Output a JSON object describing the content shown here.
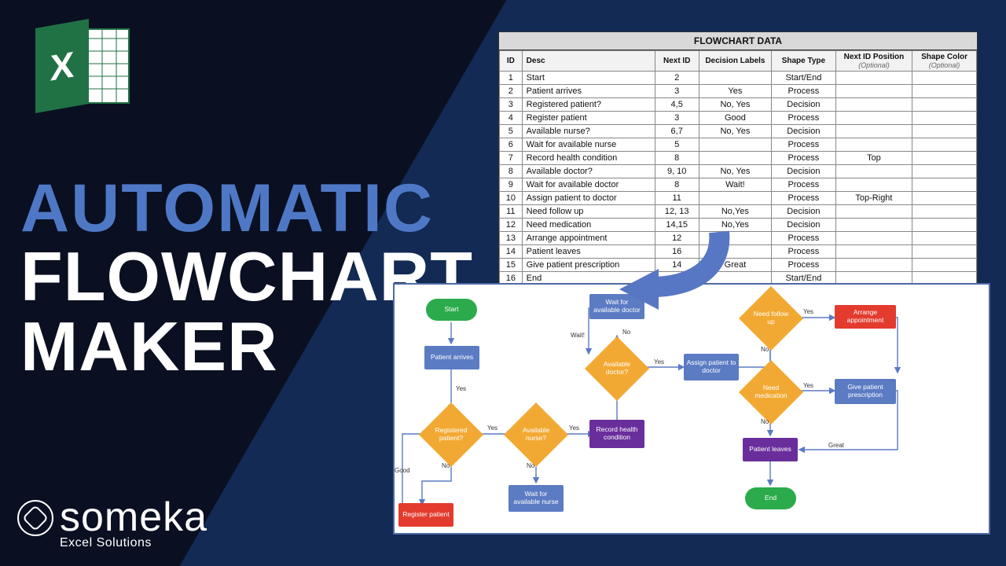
{
  "brand": {
    "name": "someka",
    "tagline": "Excel Solutions"
  },
  "excel_icon_letter": "X",
  "headline": {
    "line1": "AUTOMATIC",
    "line2": "FLOWCHART",
    "line3": "MAKER"
  },
  "table": {
    "title": "FLOWCHART DATA",
    "headers": [
      "ID",
      "Desc",
      "Next ID",
      "Decision Labels",
      "Shape Type",
      "Next ID Position",
      "Shape Color"
    ],
    "optional_note": "(Optional)",
    "rows": [
      {
        "id": "1",
        "desc": "Start",
        "next": "2",
        "labels": "",
        "shape": "Start/End",
        "pos": "",
        "color": ""
      },
      {
        "id": "2",
        "desc": "Patient arrives",
        "next": "3",
        "labels": "Yes",
        "shape": "Process",
        "pos": "",
        "color": ""
      },
      {
        "id": "3",
        "desc": "Registered patient?",
        "next": "4,5",
        "labels": "No, Yes",
        "shape": "Decision",
        "pos": "",
        "color": ""
      },
      {
        "id": "4",
        "desc": "Register patient",
        "next": "3",
        "labels": "Good",
        "shape": "Process",
        "pos": "",
        "color": ""
      },
      {
        "id": "5",
        "desc": "Available nurse?",
        "next": "6,7",
        "labels": "No, Yes",
        "shape": "Decision",
        "pos": "",
        "color": ""
      },
      {
        "id": "6",
        "desc": "Wait for available nurse",
        "next": "5",
        "labels": "",
        "shape": "Process",
        "pos": "",
        "color": ""
      },
      {
        "id": "7",
        "desc": "Record health condition",
        "next": "8",
        "labels": "",
        "shape": "Process",
        "pos": "Top",
        "color": ""
      },
      {
        "id": "8",
        "desc": "Available doctor?",
        "next": "9, 10",
        "labels": "No, Yes",
        "shape": "Decision",
        "pos": "",
        "color": ""
      },
      {
        "id": "9",
        "desc": "Wait for available doctor",
        "next": "8",
        "labels": "Wait!",
        "shape": "Process",
        "pos": "",
        "color": ""
      },
      {
        "id": "10",
        "desc": "Assign patient to doctor",
        "next": "11",
        "labels": "",
        "shape": "Process",
        "pos": "Top-Right",
        "color": ""
      },
      {
        "id": "11",
        "desc": "Need follow up",
        "next": "12, 13",
        "labels": "No,Yes",
        "shape": "Decision",
        "pos": "",
        "color": ""
      },
      {
        "id": "12",
        "desc": "Need medication",
        "next": "14,15",
        "labels": "No,Yes",
        "shape": "Decision",
        "pos": "",
        "color": ""
      },
      {
        "id": "13",
        "desc": "Arrange appointment",
        "next": "12",
        "labels": "",
        "shape": "Process",
        "pos": "",
        "color": ""
      },
      {
        "id": "14",
        "desc": "Patient leaves",
        "next": "16",
        "labels": "",
        "shape": "Process",
        "pos": "",
        "color": ""
      },
      {
        "id": "15",
        "desc": "Give patient prescription",
        "next": "14",
        "labels": "Great",
        "shape": "Process",
        "pos": "",
        "color": ""
      },
      {
        "id": "16",
        "desc": "End",
        "next": "",
        "labels": "",
        "shape": "Start/End",
        "pos": "",
        "color": ""
      }
    ]
  },
  "flow": {
    "labels": {
      "yes": "Yes",
      "no": "No",
      "good": "Good",
      "wait": "Wait!",
      "great": "Great"
    },
    "nodes": {
      "start": "Start",
      "patient_arrives": "Patient arrives",
      "registered": "Registered patient?",
      "register": "Register patient",
      "avail_nurse": "Available nurse?",
      "wait_nurse": "Wait for available nurse",
      "record": "Record health condition",
      "avail_doctor": "Available doctor?",
      "wait_doctor": "Wait for available doctor",
      "assign": "Assign patient to doctor",
      "follow": "Need follow up",
      "medication": "Need medication",
      "arrange": "Arrange appointment",
      "leaves": "Patient leaves",
      "prescription": "Give patient prescription",
      "end": "End"
    }
  }
}
